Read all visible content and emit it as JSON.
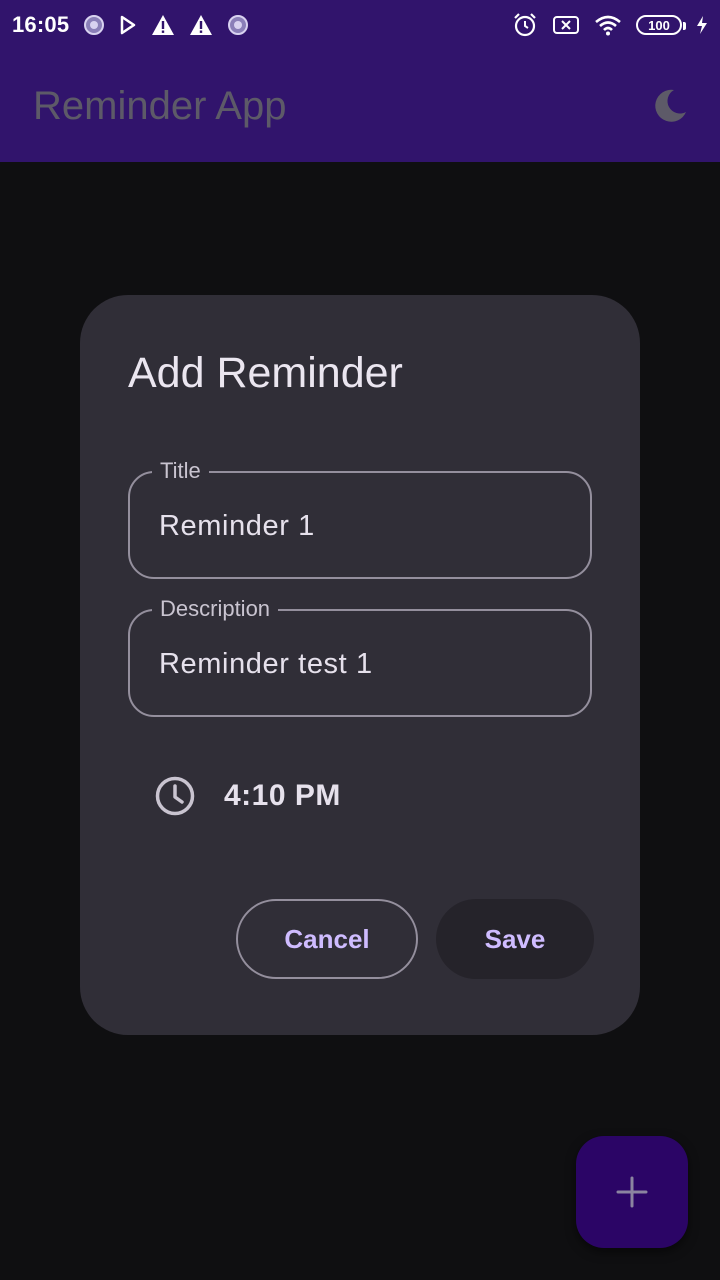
{
  "status_bar": {
    "time": "16:05",
    "battery": "100"
  },
  "app_bar": {
    "title": "Reminder App",
    "theme_icon": "moon-icon"
  },
  "dialog": {
    "title": "Add Reminder",
    "title_field": {
      "label": "Title",
      "value": "Reminder 1"
    },
    "description_field": {
      "label": "Description",
      "value": "Reminder test 1"
    },
    "time": {
      "icon": "clock-icon",
      "value": "4:10 PM"
    },
    "cancel_label": "Cancel",
    "save_label": "Save"
  },
  "fab": {
    "icon": "plus-icon"
  },
  "colors": {
    "app_bar": "#31146c",
    "background": "#0f0f11",
    "dialog": "#302e37",
    "accent": "#cfbcff",
    "fab": "#2b0566"
  }
}
